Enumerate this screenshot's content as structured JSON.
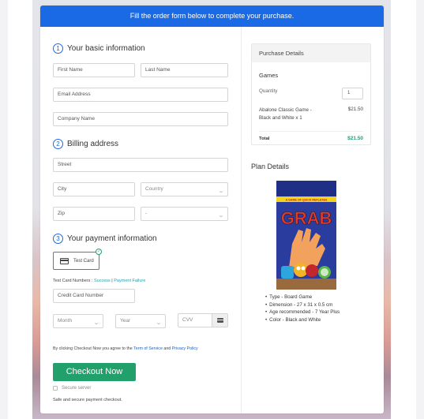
{
  "banner": {
    "text": "Fill the order form below to complete your purchase."
  },
  "basic_info": {
    "step": "1",
    "title": "Your basic information",
    "first_name_placeholder": "First Name",
    "last_name_placeholder": "Last Name",
    "email_placeholder": "Email Address",
    "company_placeholder": "Company Name"
  },
  "billing": {
    "step": "2",
    "title": "Billing address",
    "street_placeholder": "Street",
    "city_placeholder": "City",
    "country_value": "Country",
    "zip_placeholder": "Zip",
    "state_value": "-"
  },
  "payment": {
    "step": "3",
    "title": "Your payment information",
    "method_label": "Test Card",
    "test_numbers_label": "Test Card Numbers :",
    "success_link": "Success",
    "separator": "|",
    "failure_link": "Payment Failure",
    "card_number_placeholder": "Credit Card Number",
    "month_value": "Month",
    "year_value": "Year",
    "cvv_placeholder": "CVV"
  },
  "agreement": {
    "prefix": "By clicking Checkout Now you agree to the",
    "terms_link": "Term of Service",
    "and": "and",
    "privacy_link": "Privacy Policy"
  },
  "checkout": {
    "button_label": "Checkout Now",
    "secure_label": "Secure server",
    "safe_text": "Safe and secure payment checkout."
  },
  "purchase_details": {
    "title": "Purchase Details",
    "category": "Games",
    "quantity_label": "Quantity",
    "quantity_value": "1",
    "item_name_line1": "Abalone Classic Game -",
    "item_name_line2": "Black and White x 1",
    "item_price": "$21.50",
    "total_label": "Total",
    "total_value": "$21.50"
  },
  "plan_details": {
    "title": "Plan Details",
    "product_image_alt": "GRAB card game box",
    "product_brand": "GRAB",
    "product_tagline": "A GAME OF QUICK REFLEXES",
    "specs": [
      "Type - Board Game",
      "Dimension - 27 x 31 x 0.5 cm",
      "Age recommended - 7 Year Plus",
      "Color - Black and White"
    ]
  },
  "colors": {
    "banner_blue": "#1b6ae5",
    "checkout_green": "#22a06b",
    "total_green": "#22a06b",
    "link_teal": "#1aa3b3"
  }
}
